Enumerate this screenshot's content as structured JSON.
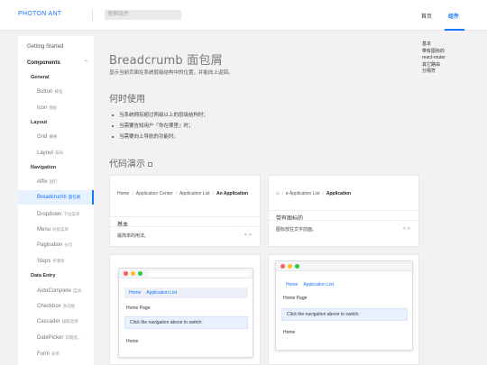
{
  "header": {
    "logo": "PHOTON ANT",
    "search_placeholder": "搜索组件",
    "nav": {
      "home": "首页",
      "components": "组件"
    }
  },
  "sidebar": {
    "getting_started": "Getting Started",
    "components": "Components",
    "groups": {
      "general": "General",
      "layout": "Layout",
      "navigation": "Navigation",
      "data_entry": "Data Entry"
    },
    "items": [
      {
        "label": "Button",
        "sub": "按钮"
      },
      {
        "label": "Icon",
        "sub": "图标"
      },
      {
        "label": "Grid",
        "sub": "栅格"
      },
      {
        "label": "Layout",
        "sub": "布局"
      },
      {
        "label": "Affix",
        "sub": "固钉"
      },
      {
        "label": "Breadcrumb",
        "sub": "面包屑"
      },
      {
        "label": "Dropdown",
        "sub": "下拉菜单"
      },
      {
        "label": "Menu",
        "sub": "导航菜单"
      },
      {
        "label": "Pagination",
        "sub": "分页"
      },
      {
        "label": "Steps",
        "sub": "步骤条"
      },
      {
        "label": "AutoComplete",
        "sub": "自动..."
      },
      {
        "label": "Checkbox",
        "sub": "多选框"
      },
      {
        "label": "Cascader",
        "sub": "级联选择"
      },
      {
        "label": "DatePicker",
        "sub": "日期选..."
      },
      {
        "label": "Form",
        "sub": "表单"
      }
    ]
  },
  "main": {
    "title": "Breadcrumb 面包屑",
    "subtitle": "显示当前页面在系统层级结构中的位置，并能向上返回。",
    "when_title": "何时使用",
    "bullets": [
      "当系统拥有超过两级以上的层级结构时；",
      "当需要告知用户『你在哪里』时；",
      "当需要向上导航的功能时。"
    ],
    "examples_title": "代码演示"
  },
  "cards": {
    "basic": {
      "crumbs": [
        "Home",
        "Application Center",
        "Application List"
      ],
      "current": "An Application",
      "meta_title": "基本",
      "meta_desc": "最简单的用法。",
      "code_toggle": "< >"
    },
    "icon": {
      "crumbs": [
        "Application List"
      ],
      "current": "Application",
      "meta_title": "带有图标的",
      "meta_desc": "图标放在文字前面。",
      "code_toggle": "< >"
    },
    "router_left": {
      "nav": [
        "Home",
        "Application List"
      ],
      "page": "Home Page",
      "note": "Click the navigation above to switch:",
      "footer": "Home"
    },
    "router_right": {
      "nav": [
        "Home",
        "Application List"
      ],
      "page": "Home Page",
      "note": "Click the navigation above to switch:",
      "footer": "Home"
    }
  },
  "toc": [
    "基本",
    "带有图标的",
    "react-router",
    "其它路由",
    "分隔符"
  ],
  "colors": {
    "accent": "#1677ff",
    "lamp_red": "#ff5f57",
    "lamp_yellow": "#febc2e",
    "lamp_green": "#28c840"
  }
}
